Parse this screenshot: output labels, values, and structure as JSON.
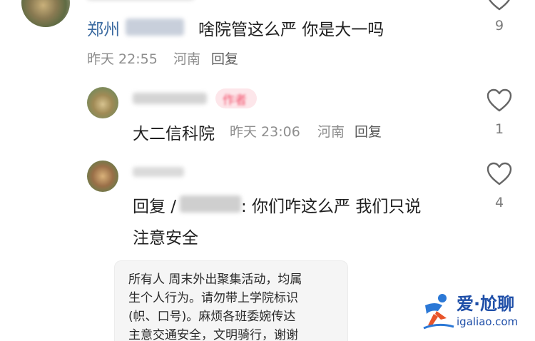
{
  "comments": [
    {
      "username": "郑州",
      "text": "啥院管这么严 你是大一吗",
      "meta_time": "昨天 22:55",
      "meta_location": "河南",
      "reply_label": "回复",
      "like_count": "9"
    },
    {
      "author_badge": "作者",
      "text": "大二信科院",
      "meta_time": "昨天 23:06",
      "meta_location": "河南",
      "reply_label": "回复",
      "like_count": "1"
    },
    {
      "reply_prefix": "回复 /",
      "reply_text_line1": ": 你们咋这么严 我们只说",
      "reply_text_line2": "注意安全",
      "like_count": "4"
    }
  ],
  "notice_card": {
    "lines": [
      "所有人 周末外出聚集活动，均属",
      "生个人行为。请勿带上学院标识",
      "(帜、口号)。麻烦各班委婉传达",
      "主意交通安全，文明骑行，谢谢"
    ]
  },
  "watermark": {
    "brand": "爱·尬聊",
    "url": "igaliao.com"
  },
  "colors": {
    "username": "#3b6aa0",
    "meta": "#8e8e8e",
    "badge_text": "#f2546e",
    "badge_bg": "#fde6ea",
    "watermark": "#1f4fa8"
  }
}
